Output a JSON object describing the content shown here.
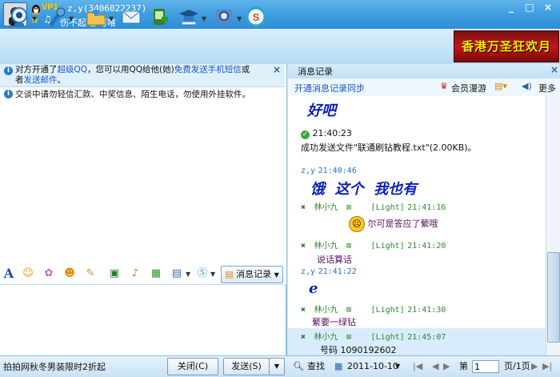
{
  "title_bar": {
    "vip": "VP1",
    "contact_name": "z,y(3406022237)",
    "signature": "伤不起-那可唯",
    "controls": [
      "_",
      "□",
      "×"
    ]
  },
  "toolbar": {
    "items": [
      "video-icon",
      "voice-icon",
      "folder-icon",
      "email-icon",
      "sms-icon",
      "graduate-icon",
      "settings-icon",
      "sogou-icon"
    ]
  },
  "ad_banner": "香港万圣狂欢月",
  "notice": {
    "line1_prefix": "对方开通了",
    "line1_link": "超级QQ",
    "line1_mid": "，您可以用QQ给他(她)",
    "line1_link2": "免费发送手机短信",
    "line1_suffix": "或",
    "line2_prefix": "者",
    "line2_link": "发送邮件",
    "line2_suffix": "。",
    "warning": "交谈中请勿轻信汇款、中奖信息、陌生电话，勿使用外挂软件。"
  },
  "input_toolbar": {
    "msg_record_label": "消息记录"
  },
  "bottom": {
    "ad_text": "拍拍网秋冬男装限时2折起",
    "close_label": "关闭(C)",
    "send_label": "发送(S)"
  },
  "history_panel": {
    "title": "消息记录",
    "sync_link": "开通消息记录同步",
    "member_label": "会员漫游",
    "more_label": "更多",
    "messages": [
      {
        "type": "big",
        "text": "好吧"
      },
      {
        "type": "file_time",
        "time": "21:40:23",
        "text": "成功发送文件\"联通刷钻教程.txt\"(2.00KB)。"
      },
      {
        "type": "header",
        "sender": "z,y",
        "time": "21:40:46"
      },
      {
        "type": "big",
        "text": "饿  这个  我也有"
      },
      {
        "type": "header2",
        "sender": "林小九",
        "tag": "[Light]",
        "time": "21:41:16"
      },
      {
        "type": "text",
        "text": "尔可是答应了蘩哦"
      },
      {
        "type": "header2",
        "sender": "林小九",
        "tag": "[Light]",
        "time": "21:41:20"
      },
      {
        "type": "text",
        "text": "说话算话"
      },
      {
        "type": "header",
        "sender": "z,y",
        "time": "21:41:22"
      },
      {
        "type": "big",
        "text": "e"
      },
      {
        "type": "header2",
        "sender": "林小九",
        "tag": "[Light]",
        "time": "21:41:30"
      },
      {
        "type": "text",
        "text": "蘩要一绿钻"
      },
      {
        "type": "header2",
        "sender": "林小九",
        "tag": "[Light]",
        "time": "21:45:07"
      },
      {
        "type": "text",
        "text": "号码  1090192602"
      }
    ]
  },
  "pager": {
    "search_label": "查找",
    "date": "2011-10-10",
    "page_prefix": "第",
    "page_value": "1",
    "page_suffix": "页/1页"
  }
}
